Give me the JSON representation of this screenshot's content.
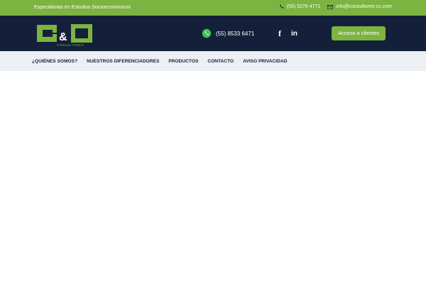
{
  "topbar": {
    "tagline": "Especialistas en Estudios Socioeconómicos",
    "phone": "(55) 5276 4771",
    "email": "info@consultores-cc.com"
  },
  "header": {
    "logo_text": "C&C",
    "logo_subtext": "CONSULTORES",
    "whatsapp_phone": "(55) 8533 6471",
    "client_button": "Acceso a clientes"
  },
  "nav": {
    "items": [
      {
        "label": "¿QUIÉNES SOMOS?"
      },
      {
        "label": "NUESTROS DIFERENCIADORES"
      },
      {
        "label": "PRODUCTOS"
      },
      {
        "label": "CONTACTO"
      },
      {
        "label": "AVISO PRIVACIDAD"
      }
    ]
  },
  "colors": {
    "accent": "#7cb341",
    "header_bg": "#14203a",
    "nav_bg": "#eceff3"
  }
}
